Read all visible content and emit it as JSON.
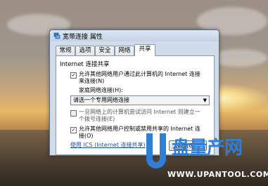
{
  "window": {
    "title": "宽带连接 属性",
    "title_icon": "network-icon"
  },
  "tabs": [
    {
      "label": "常规",
      "active": false
    },
    {
      "label": "选项",
      "active": false
    },
    {
      "label": "安全",
      "active": false
    },
    {
      "label": "网络",
      "active": false
    },
    {
      "label": "共享",
      "active": true
    }
  ],
  "sharing": {
    "group_title": "Internet 连接共享",
    "allow_sharing": {
      "checked": true,
      "line1": "允许其他网络用户通过此计算机的 Internet 连接",
      "line2": "来连接(N)"
    },
    "home_network_label": "家庭网络连接(H):",
    "home_network_select": "请选一个专用网络连接",
    "dial_on_demand": {
      "checked": false,
      "line1": "一旦网络上的计算机尝试访问 Internet 则建立一",
      "line2": "个拨号连接(E)"
    },
    "allow_control": {
      "checked": true,
      "line1": "允许其他网络用户控制或禁用共享的 Internet 连",
      "line2": "接(O)"
    },
    "ics_link": "使用 ICS (Internet 连接共享)",
    "settings_button": "设置(G)..."
  },
  "watermark": {
    "brand": "盘量产网",
    "url": "WWW.UPANTOOL.COM"
  },
  "colors": {
    "link": "#1c4fa8",
    "brand_blue": "#2f7fd8"
  }
}
